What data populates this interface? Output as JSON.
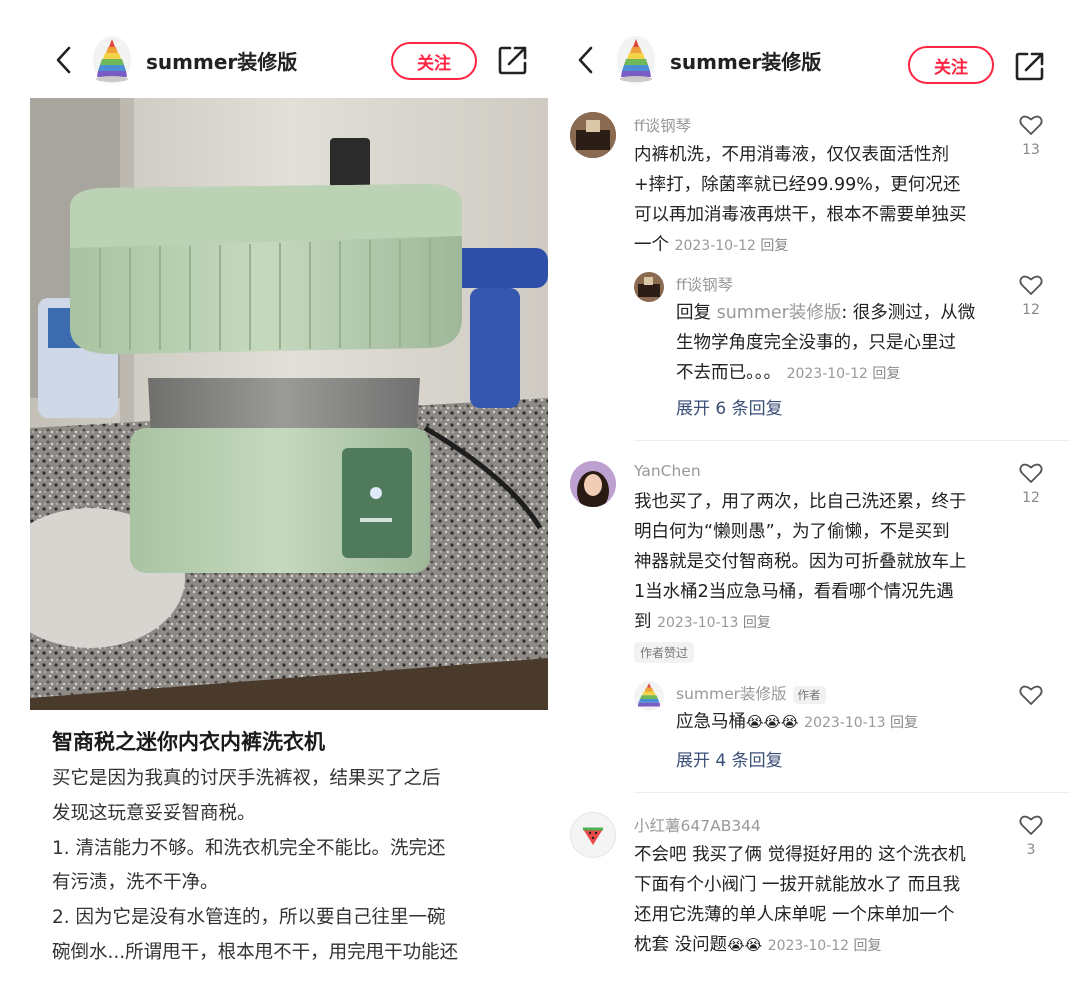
{
  "header": {
    "author_name": "summer装修版",
    "follow_label": "关注"
  },
  "post": {
    "title": "智商税之迷你内衣内裤洗衣机",
    "body_lines": [
      "买它是因为我真的讨厌手洗裤衩，结果买了之后",
      "发现这玩意妥妥智商税。",
      "1. 清洁能力不够。和洗衣机完全不能比。洗完还",
      "有污渍，洗不干净。",
      "2. 因为它是没有水管连的，所以要自己往里一碗",
      "碗倒水...所谓甩干，根本甩不干，用完甩干功能还"
    ]
  },
  "comments": [
    {
      "name": "ff谈钢琴",
      "lines": [
        "内裤机洗，不用消毒液，仅仅表面活性剂",
        "+摔打，除菌率就已经99.99%，更何况还",
        "可以再加消毒液再烘干，根本不需要单独买",
        "一个"
      ],
      "date": "2023-10-12",
      "reply_label": "回复",
      "likes": "13",
      "sub": {
        "name": "ff谈钢琴",
        "reply_prefix": "回复",
        "reply_to": "summer装修版",
        "lines": [
          ": 很多测过，从微",
          "生物学角度完全没事的，只是心里过",
          "不去而已。。。"
        ],
        "date": "2023-10-12",
        "reply_label": "回复",
        "likes": "12"
      },
      "expand_label": "展开 6 条回复"
    },
    {
      "name": "YanChen",
      "lines": [
        "我也买了，用了两次，比自己洗还累，终于",
        "明白何为“懒则愚”，为了偷懒，不是买到",
        "神器就是交付智商税。因为可折叠就放车上",
        "1当水桶2当应急马桶，看看哪个情况先遇",
        "到"
      ],
      "date": "2023-10-13",
      "reply_label": "回复",
      "likes": "12",
      "author_liked_tag": "作者赞过",
      "sub": {
        "name": "summer装修版",
        "author_badge": "作者",
        "text": "应急马桶",
        "date": "2023-10-13",
        "reply_label": "回复"
      },
      "expand_label": "展开 4 条回复"
    },
    {
      "name": "小红薯647AB344",
      "lines": [
        "不会吧 我买了俩 觉得挺好用的 这个洗衣机",
        "下面有个小阀门 一拔开就能放水了 而且我",
        "还用它洗薄的单人床单呢 一个床单加一个",
        "枕套 没问题"
      ],
      "date": "2023-10-12",
      "reply_label": "回复",
      "likes": "3"
    }
  ],
  "colors": {
    "accent": "#ff2442",
    "expand": "#3a4f78",
    "muted": "#999999"
  },
  "icons": [
    "back-arrow-icon",
    "share-icon",
    "heart-outline-icon",
    "crying-emoji-icon"
  ]
}
